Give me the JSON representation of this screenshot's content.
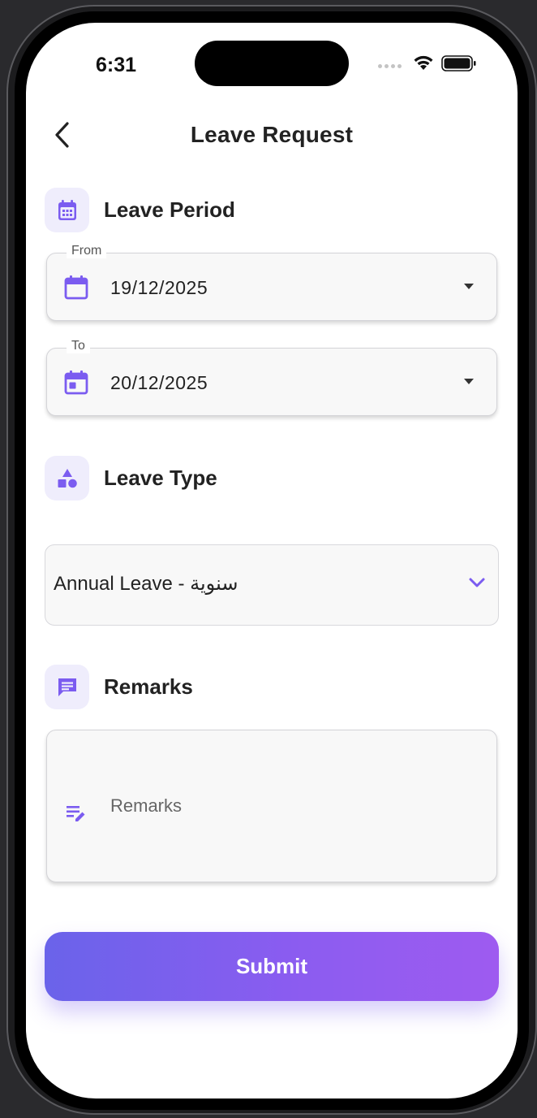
{
  "status_bar": {
    "time": "6:31"
  },
  "header": {
    "title": "Leave Request"
  },
  "leave_period": {
    "title": "Leave Period",
    "from": {
      "label": "From",
      "value": "19/12/2025"
    },
    "to": {
      "label": "To",
      "value": "20/12/2025"
    }
  },
  "leave_type": {
    "title": "Leave Type",
    "selected": "Annual Leave - سنوية"
  },
  "remarks": {
    "title": "Remarks",
    "placeholder": "Remarks",
    "value": ""
  },
  "submit": {
    "label": "Submit"
  },
  "colors": {
    "accent": "#7b5cf0",
    "icon_bg": "#efedfc",
    "gradient_start": "#6a63ea",
    "gradient_end": "#9e5bf0"
  },
  "icons": {
    "back": "chevron-left-icon",
    "leave_period": "calendar-grid-icon",
    "from": "calendar-icon",
    "to": "calendar-event-icon",
    "leave_type": "shapes-icon",
    "remarks_section": "chat-bubble-icon",
    "remarks_field": "edit-note-icon",
    "select": "chevron-down-icon"
  }
}
